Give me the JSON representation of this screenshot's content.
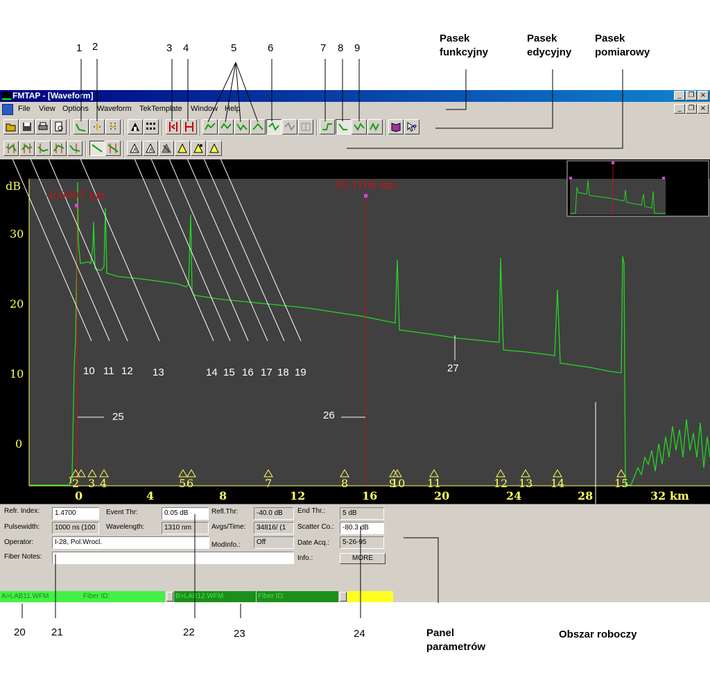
{
  "callouts": {
    "top_numbers": [
      "1",
      "2",
      "3",
      "4",
      "5",
      "6",
      "7",
      "8",
      "9"
    ],
    "inner_numbers": [
      "10",
      "11",
      "12",
      "13",
      "14",
      "15",
      "16",
      "17",
      "18",
      "19",
      "27",
      "25",
      "26"
    ],
    "bottom_numbers": [
      "20",
      "21",
      "22",
      "23",
      "24"
    ],
    "captions": {
      "function_bar": "Pasek funkcyjny",
      "edit_bar": "Pasek edycyjny",
      "measure_bar": "Pasek pomiarowy",
      "param_panel": "Panel parametrów",
      "work_area": "Obszar roboczy"
    }
  },
  "window": {
    "title": "FMTAP - [Waveform]",
    "controls": [
      "_",
      "❐",
      "×"
    ]
  },
  "menu": [
    "File",
    "View",
    "Options",
    "Waveform",
    "TekTemplate",
    "Window",
    "Help"
  ],
  "icons": {
    "toolbar1": [
      "open-icon",
      "save-icon",
      "print-icon",
      "print-preview-icon",
      "waveform-zoom-icon",
      "waveform-dots-icon",
      "waveform-markers-icon",
      "marker-a-icon",
      "far-marker-icon",
      "cursor-left-icon",
      "cursor-right-icon",
      "trace-event-icon",
      "trace-event-icon",
      "trace-event-icon",
      "trace-event-icon",
      "event-active-icon",
      "event-move-icon",
      "event-grid-icon",
      "splice-icon",
      "reflect-icon",
      "loss-icon",
      "loss-detail-icon",
      "book-icon",
      "help-icon"
    ],
    "toolbar2": [
      "measure-1-icon",
      "measure-2-icon",
      "measure-3-icon",
      "measure-4-icon",
      "measure-5-icon",
      "slope-icon",
      "slope-detail-icon",
      "event-add-icon",
      "event-add-alt-icon",
      "event-delete-icon",
      "event-mark-1-icon",
      "event-mark-2-icon",
      "event-mark-3-icon"
    ]
  },
  "graph": {
    "y_unit": "dB",
    "y_ticks": [
      "30",
      "20",
      "10",
      "0"
    ],
    "x_ticks": [
      "0",
      "4",
      "8",
      "12",
      "16",
      "20",
      "24",
      "28",
      "32 km"
    ],
    "cursor_a": "-0.0007 km",
    "cursor_b": "16.1106 km",
    "events": [
      "1",
      "2",
      "3",
      "4",
      "5",
      "6",
      "7",
      "8",
      "9",
      "10",
      "11",
      "12",
      "13",
      "14",
      "15"
    ],
    "colors": {
      "trace": "#22d822",
      "cursor": "#c81010",
      "axis": "#ffff60",
      "background": "#404040"
    }
  },
  "params": {
    "refr_index_label": "Refr. Index:",
    "refr_index": "1.4700",
    "pulsewidth_label": "Pulsewidth:",
    "pulsewidth": "1000 ns (100",
    "operator_label": "Operator:",
    "operator": "I-28, Pol.Wrocl.",
    "fiber_notes_label": "Fiber Notes:",
    "fiber_notes": "",
    "event_thr_label": "Event Thr:",
    "event_thr": "0.05 dB",
    "wavelength_label": "Wavelength:",
    "wavelength": "1310 nm",
    "refl_thr_label": "Refl.Thr:",
    "refl_thr": "-40.0 dB",
    "avgs_time_label": "Avgs/Time:",
    "avgs_time": "34816/ (1",
    "modinfo_label": "ModInfo.:",
    "modinfo": "Off",
    "end_thr_label": "End Thr.:",
    "end_thr": "5 dB",
    "scatter_label": "Scatter Co.:",
    "scatter": "-80.3 dB",
    "date_acq_label": "Date Acq.:",
    "date_acq": "5-26-95",
    "info_label": "Info.:",
    "more_button": "MORE"
  },
  "files": {
    "a_file": "A>LAB11.WFM",
    "a_fiber": "Fiber ID:",
    "b_file": "B>LAB12.WFM",
    "b_fiber": "Fiber ID:"
  }
}
